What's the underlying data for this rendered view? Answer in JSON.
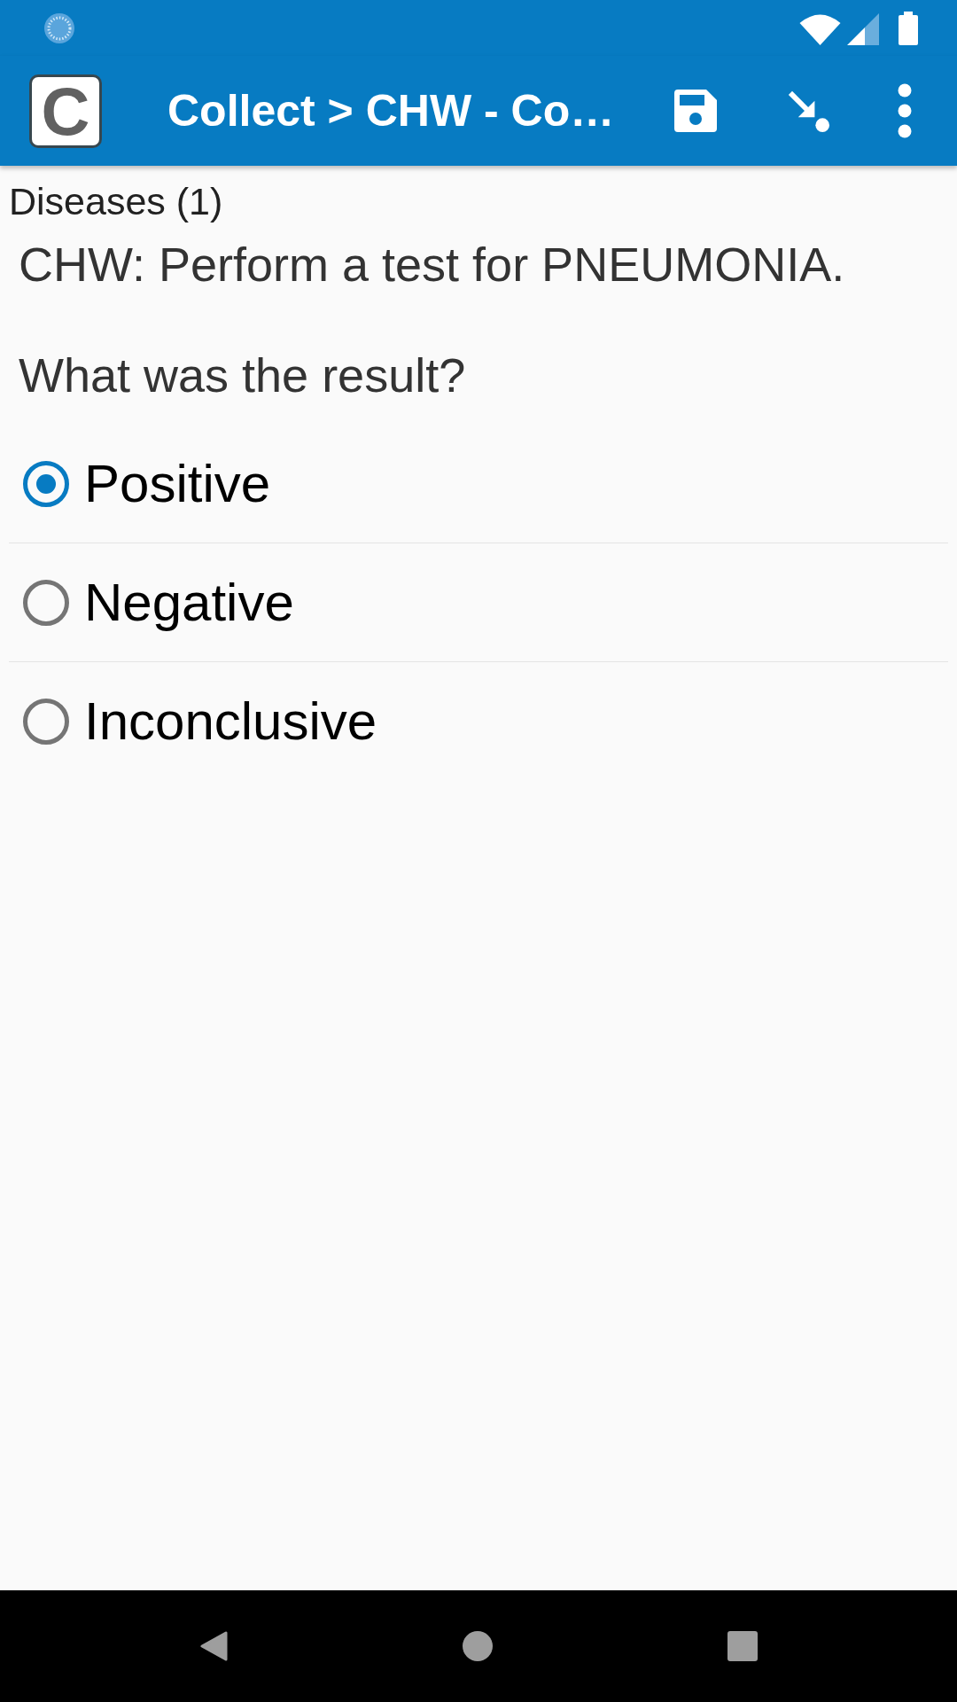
{
  "app_bar": {
    "logo": "C",
    "title": "Collect > CHW - Co…"
  },
  "form": {
    "group": "Diseases (1)",
    "prompt": "CHW: Perform a test for PNEUMONIA.",
    "question": "What was the result?",
    "options": [
      {
        "label": "Positive",
        "selected": true
      },
      {
        "label": "Negative",
        "selected": false
      },
      {
        "label": "Inconclusive",
        "selected": false
      }
    ]
  }
}
